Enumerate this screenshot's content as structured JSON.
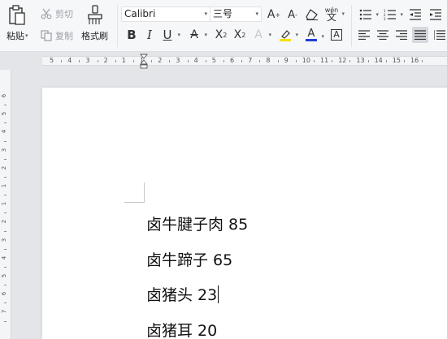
{
  "ribbon": {
    "paste_label": "粘贴",
    "cut_label": "剪切",
    "copy_label": "复制",
    "format_painter_label": "格式刷",
    "font_name": "Calibri",
    "font_size": "三号",
    "icons": [
      "paste-icon",
      "cut-icon",
      "copy-icon",
      "format-painter-icon",
      "bold-icon",
      "italic-icon",
      "underline-icon",
      "strikethrough-icon",
      "superscript-icon",
      "subscript-icon",
      "text-effect-icon",
      "highlight-icon",
      "font-color-icon",
      "char-border-icon",
      "grow-font-icon",
      "shrink-font-icon",
      "clear-format-icon",
      "phonetic-guide-icon",
      "bullets-icon",
      "numbering-icon",
      "decrease-indent-icon",
      "align-left-icon",
      "align-center-icon",
      "align-right-icon",
      "justify-icon",
      "distributed-icon"
    ],
    "colors": {
      "highlight": "#f6e000",
      "font_color": "#1f3fd0",
      "active_bg": "#d5d8dc"
    }
  },
  "ruler": {
    "labels": [
      "5",
      "4",
      "3",
      "2",
      "1",
      "1",
      "2",
      "3",
      "4",
      "5",
      "6",
      "7",
      "8",
      "9",
      "10",
      "11",
      "12",
      "13",
      "14",
      "15",
      "16"
    ]
  },
  "vruler": {
    "labels": [
      "6",
      "5",
      "4",
      "3",
      "2",
      "1",
      "1",
      "2",
      "3",
      "4",
      "5",
      "6",
      "7"
    ]
  },
  "document": {
    "lines": [
      "卤牛腱子肉 85",
      "卤牛蹄子 65",
      "卤猪头 23",
      "卤猪耳 20"
    ]
  }
}
